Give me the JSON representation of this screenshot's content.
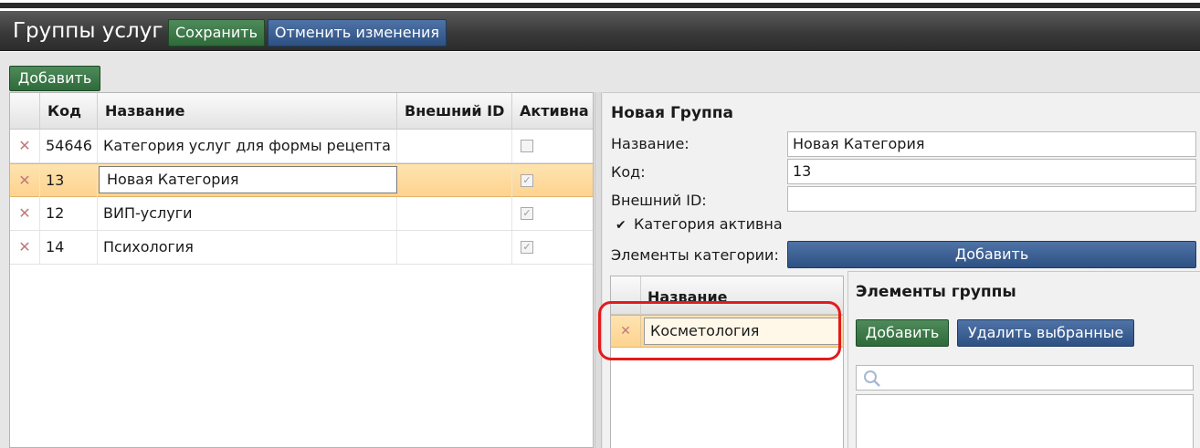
{
  "header": {
    "title": "Группы услуг",
    "save_label": "Сохранить",
    "cancel_label": "Отменить изменения"
  },
  "toolbar": {
    "add_label": "Добавить"
  },
  "grid": {
    "columns": [
      "Код",
      "Название",
      "Внешний ID",
      "Активна"
    ],
    "rows": [
      {
        "code": "54646",
        "name": "Категория услуг для формы рецепта",
        "external_id": "",
        "active": false,
        "selected": false
      },
      {
        "code": "13",
        "name": "Новая Категория",
        "external_id": "",
        "active": true,
        "selected": true
      },
      {
        "code": "12",
        "name": "ВИП-услуги",
        "external_id": "",
        "active": true,
        "selected": false
      },
      {
        "code": "14",
        "name": "Психология",
        "external_id": "",
        "active": true,
        "selected": false
      }
    ]
  },
  "form": {
    "title": "Новая Группа",
    "name_label": "Название:",
    "name_value": "Новая Категория",
    "code_label": "Код:",
    "code_value": "13",
    "external_label": "Внешний ID:",
    "external_value": "",
    "active_label": "Категория активна",
    "active_checked": true,
    "elements_label": "Элементы категории:",
    "elements_add_label": "Добавить"
  },
  "category_elements": {
    "column": "Название",
    "rows": [
      "Косметология"
    ]
  },
  "group_elements": {
    "title": "Элементы группы",
    "add_label": "Добавить",
    "delete_label": "Удалить выбранные",
    "search_placeholder": ""
  },
  "colors": {
    "green_button": "#2f6a3b",
    "blue_button": "#2e5184",
    "selection": "#fdd38f",
    "highlight": "#e31b1b"
  }
}
